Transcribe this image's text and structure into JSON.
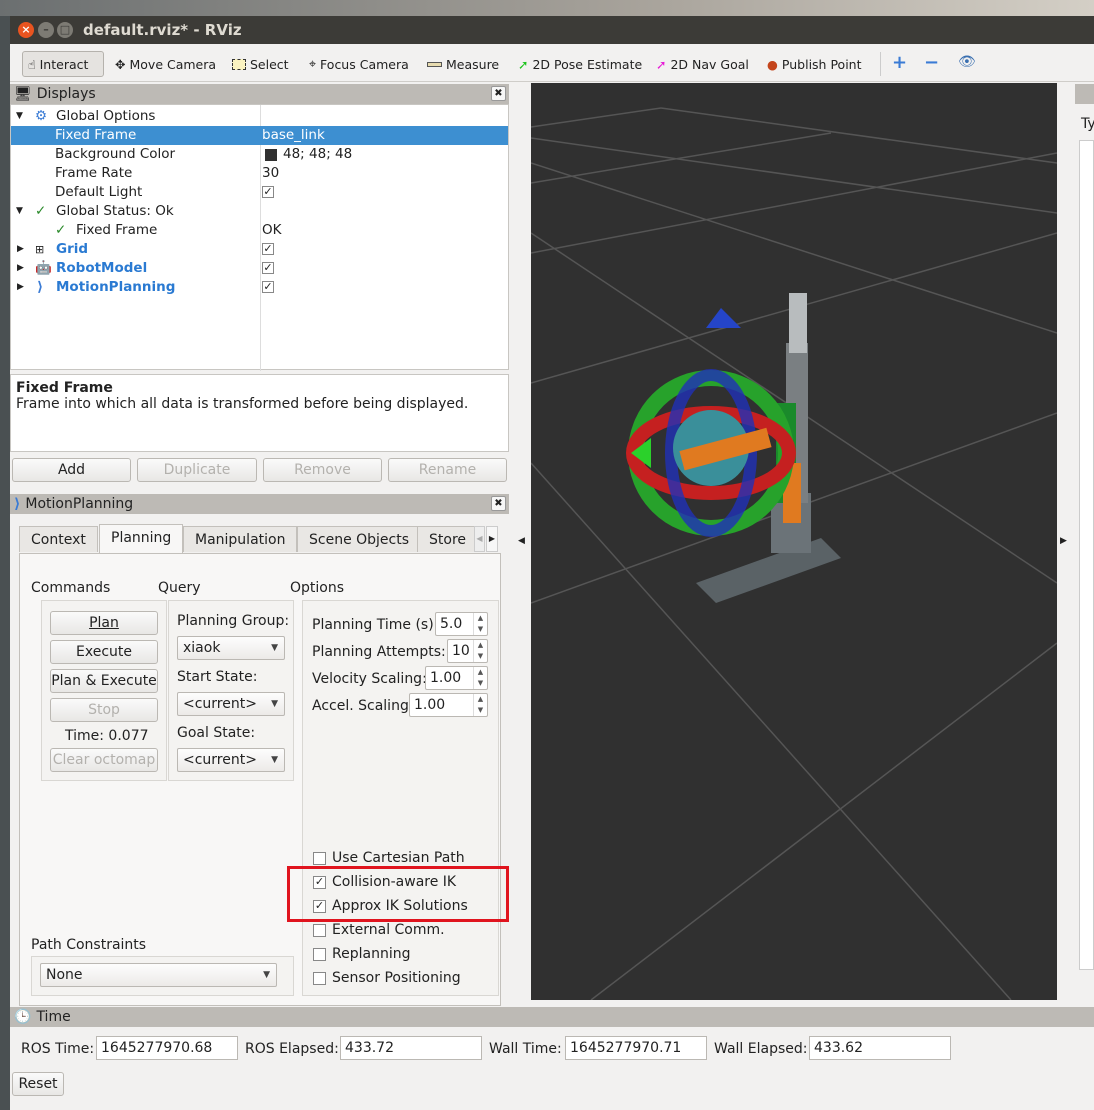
{
  "window": {
    "title": "default.rviz* - RViz"
  },
  "toolbar": {
    "items": [
      {
        "label": "Interact",
        "icon": "hand-icon"
      },
      {
        "label": "Move Camera",
        "icon": "move-camera-icon"
      },
      {
        "label": "Select",
        "icon": "select-icon"
      },
      {
        "label": "Focus Camera",
        "icon": "focus-camera-icon"
      },
      {
        "label": "Measure",
        "icon": "ruler-icon"
      },
      {
        "label": "2D Pose Estimate",
        "icon": "green-arrow-icon"
      },
      {
        "label": "2D Nav Goal",
        "icon": "pink-arrow-icon"
      },
      {
        "label": "Publish Point",
        "icon": "map-pin-icon"
      }
    ]
  },
  "displays": {
    "title": "Displays",
    "rows": [
      {
        "name": "Global Options",
        "value": ""
      },
      {
        "name": "Fixed Frame",
        "value": "base_link"
      },
      {
        "name": "Background Color",
        "value": "48; 48; 48"
      },
      {
        "name": "Frame Rate",
        "value": "30"
      },
      {
        "name": "Default Light",
        "value": "✓"
      },
      {
        "name": "Global Status: Ok",
        "value": ""
      },
      {
        "name": "Fixed Frame",
        "value": "OK"
      },
      {
        "name": "Grid",
        "value": "✓"
      },
      {
        "name": "RobotModel",
        "value": "✓"
      },
      {
        "name": "MotionPlanning",
        "value": "✓"
      }
    ],
    "desc_title": "Fixed Frame",
    "desc_text": "Frame into which all data is transformed before being displayed.",
    "buttons": {
      "add": "Add",
      "duplicate": "Duplicate",
      "remove": "Remove",
      "rename": "Rename"
    },
    "background_color": "#303030",
    "accent": "#3d8fd1"
  },
  "motion": {
    "title": "MotionPlanning",
    "tabs": [
      "Context",
      "Planning",
      "Manipulation",
      "Scene Objects",
      "Store"
    ],
    "commands": {
      "title": "Commands",
      "plan": "Plan",
      "execute": "Execute",
      "plan_execute": "Plan & Execute",
      "stop": "Stop",
      "time": "Time: 0.077",
      "clear": "Clear octomap"
    },
    "query": {
      "title": "Query",
      "group_label": "Planning Group:",
      "group": "xiaok",
      "start_label": "Start State:",
      "start": "<current>",
      "goal_label": "Goal State:",
      "goal": "<current>"
    },
    "options": {
      "title": "Options",
      "planning_time_label": "Planning Time (s):",
      "planning_time": "5.0",
      "attempts_label": "Planning Attempts:",
      "attempts": "10",
      "velocity_label": "Velocity Scaling:",
      "velocity": "1.00",
      "accel_label": "Accel. Scaling:",
      "accel": "1.00",
      "checks": [
        {
          "label": "Use Cartesian Path",
          "checked": false
        },
        {
          "label": "Collision-aware IK",
          "checked": true
        },
        {
          "label": "Approx IK Solutions",
          "checked": true
        },
        {
          "label": "External Comm.",
          "checked": false
        },
        {
          "label": "Replanning",
          "checked": false
        },
        {
          "label": "Sensor Positioning",
          "checked": false
        }
      ]
    },
    "path_constraints": {
      "label": "Path Constraints",
      "value": "None"
    }
  },
  "right_panel": {
    "partial": "Ty"
  },
  "time": {
    "title": "Time",
    "ros_time_label": "ROS Time:",
    "ros_time": "1645277970.68",
    "ros_elapsed_label": "ROS Elapsed:",
    "ros_elapsed": "433.72",
    "wall_time_label": "Wall Time:",
    "wall_time": "1645277970.71",
    "wall_elapsed_label": "Wall Elapsed:",
    "wall_elapsed": "433.62",
    "reset": "Reset"
  }
}
